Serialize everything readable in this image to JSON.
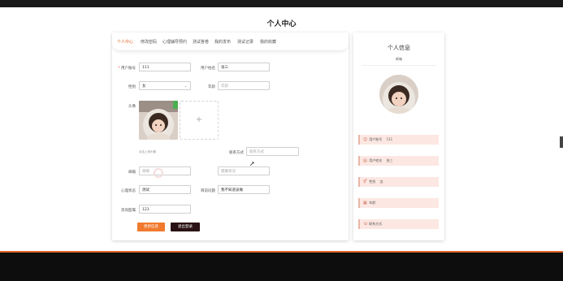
{
  "page": {
    "title": "个人中心"
  },
  "tabs": [
    "个人中心",
    "修改密码",
    "心理辅导预约",
    "测试答卷",
    "我的发布",
    "测试记录",
    "我的收藏"
  ],
  "form": {
    "username": {
      "label": "用户账号",
      "value": "111"
    },
    "name": {
      "label": "用户姓名",
      "value": "张三"
    },
    "gender": {
      "label": "性别",
      "value": "女"
    },
    "age": {
      "label": "年龄",
      "placeholder": "年龄"
    },
    "avatar": {
      "label": "头像",
      "hint": "点击上传头像"
    },
    "contact": {
      "label": "联系方式",
      "placeholder": "联系方式"
    },
    "email": {
      "label": "邮箱",
      "placeholder": "邮箱"
    },
    "health": {
      "label": "健康状况",
      "placeholder": "健康状况"
    },
    "mental": {
      "label": "心理状态",
      "value": "测试"
    },
    "trouble": {
      "label": "目前问题",
      "value": "我不知道该做"
    },
    "advisor": {
      "label": "资询医嘱",
      "value": "123"
    },
    "update_button": "更新信息",
    "logout_button": "退出登录"
  },
  "profile": {
    "title": "个人信息",
    "subtitle": "邮箱",
    "items": [
      {
        "icon": "user-icon",
        "label": "用户账号",
        "value": "111"
      },
      {
        "icon": "id-card-icon",
        "label": "用户姓名",
        "value": "张三"
      },
      {
        "icon": "gender-icon",
        "label": "性别",
        "value": "女"
      },
      {
        "icon": "calendar-icon",
        "label": "年龄",
        "value": ""
      },
      {
        "icon": "contact-icon",
        "label": "联系方式",
        "value": ""
      }
    ]
  },
  "colors": {
    "accent": "#e0662a",
    "button_primary": "#f07a2e",
    "button_dark": "#2a1214",
    "info_bg": "#fce7e2"
  }
}
